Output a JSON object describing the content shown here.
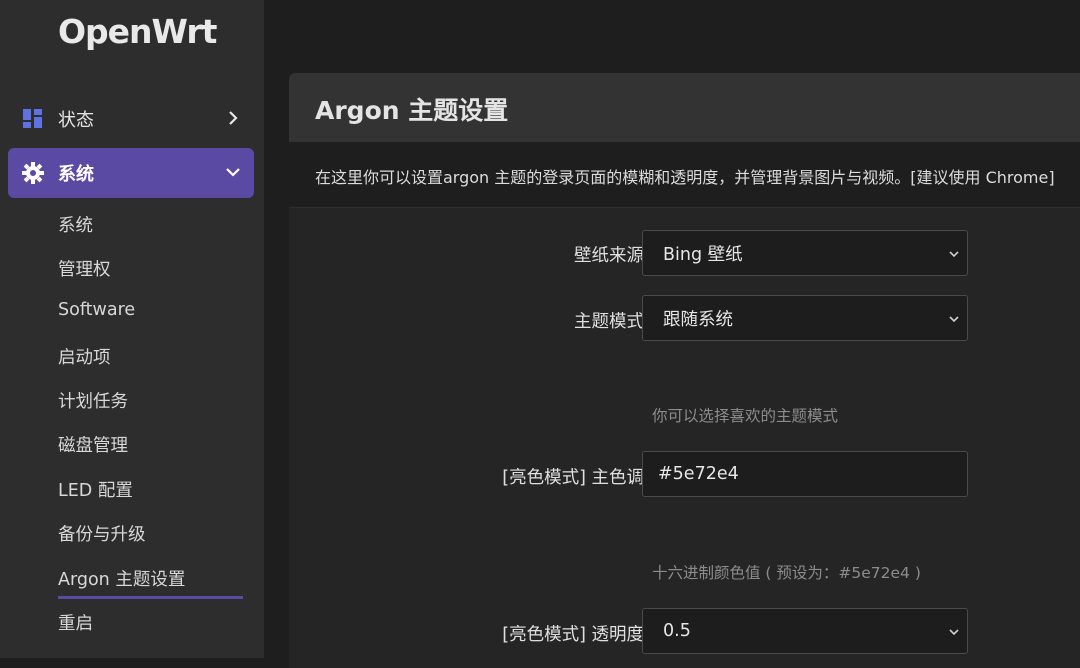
{
  "app": {
    "logo": "OpenWrt"
  },
  "sidebar": {
    "status": {
      "label": "状态",
      "icon": "dashboard-icon"
    },
    "system": {
      "label": "系统",
      "icon": "gear-icon"
    },
    "sub_items": [
      {
        "label": "系统"
      },
      {
        "label": "管理权"
      },
      {
        "label": "Software"
      },
      {
        "label": "启动项"
      },
      {
        "label": "计划任务"
      },
      {
        "label": "磁盘管理"
      },
      {
        "label": "LED 配置"
      },
      {
        "label": "备份与升级"
      },
      {
        "label": "Argon 主题设置",
        "active": true
      },
      {
        "label": "重启"
      }
    ]
  },
  "page": {
    "title": "Argon 主题设置",
    "description": "在这里你可以设置argon 主题的登录页面的模糊和透明度，并管理背景图片与视频。[建议使用 Chrome]"
  },
  "form": {
    "wallpaper_source": {
      "label": "壁纸来源",
      "value": "Bing 壁纸"
    },
    "theme_mode": {
      "label": "主题模式",
      "value": "跟随系统",
      "hint": "你可以选择喜欢的主题模式"
    },
    "light_primary": {
      "label": "[亮色模式] 主色调",
      "value": "#5e72e4",
      "hint": "十六进制颜色值 ( 预设为：#5e72e4 )"
    },
    "light_transparency": {
      "label": "[亮色模式] 透明度",
      "value": "0.5"
    }
  },
  "colors": {
    "accent": "#5b4aa3",
    "sidebar_bg": "#2d2d2d",
    "panel_bg": "#252525"
  }
}
